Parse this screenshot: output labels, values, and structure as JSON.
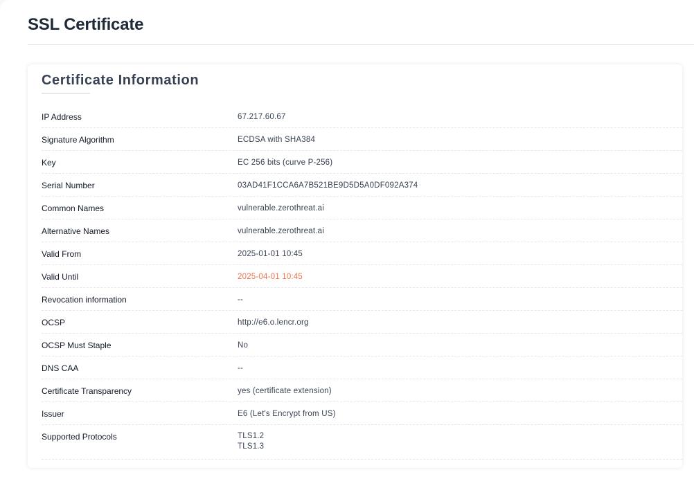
{
  "page": {
    "title": "SSL Certificate"
  },
  "card": {
    "title": "Certificate Information",
    "rows": [
      {
        "label": "IP Address",
        "value": "67.217.60.67"
      },
      {
        "label": "Signature Algorithm",
        "value": "ECDSA with SHA384"
      },
      {
        "label": "Key",
        "value": "EC 256 bits (curve P-256)"
      },
      {
        "label": "Serial Number",
        "value": "03AD41F1CCA6A7B521BE9D5D5A0DF092A374"
      },
      {
        "label": "Common Names",
        "value": "vulnerable.zerothreat.ai"
      },
      {
        "label": "Alternative Names",
        "value": "vulnerable.zerothreat.ai"
      },
      {
        "label": "Valid From",
        "value": "2025-01-01 10:45"
      },
      {
        "label": "Valid Until",
        "value": "2025-04-01 10:45"
      },
      {
        "label": "Revocation information",
        "value": "--"
      },
      {
        "label": "OCSP",
        "value": "http://e6.o.lencr.org"
      },
      {
        "label": "OCSP Must Staple",
        "value": "No"
      },
      {
        "label": "DNS CAA",
        "value": "--"
      },
      {
        "label": "Certificate Transparency",
        "value": "yes (certificate extension)"
      },
      {
        "label": "Issuer",
        "value": "E6 (Let's Encrypt from US)"
      },
      {
        "label": "Supported Protocols",
        "values": [
          "TLS1.2",
          "TLS1.3"
        ]
      }
    ]
  },
  "colors": {
    "expired_value": "#f2744b",
    "title_text": "#1f2937",
    "row_divider": "#e5e7eb"
  }
}
